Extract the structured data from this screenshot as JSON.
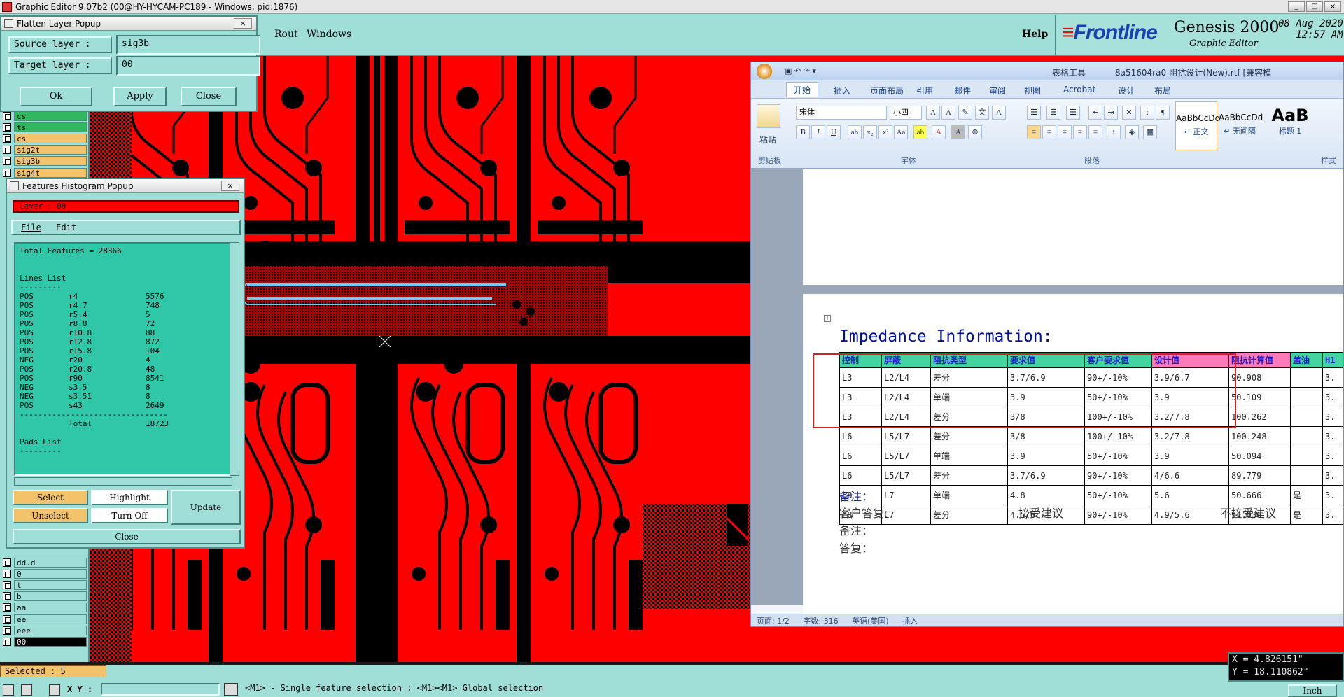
{
  "app": {
    "title": "Graphic Editor 9.07b2 (00@HY-HYCAM-PC189 - Windows, pid:1876)",
    "menu": [
      "Rout",
      "Windows"
    ],
    "help": "Help",
    "brand": {
      "logo": "Frontline",
      "product": "Genesis 2000",
      "subtitle": "Graphic Editor",
      "date": "08 Aug 2020",
      "time": "12:57 AM"
    }
  },
  "flatten_popup": {
    "title": "Flatten Layer Popup",
    "source_label": "Source layer :",
    "source_value": "sig3b",
    "target_label": "Target layer :",
    "target_value": "00",
    "buttons": [
      "Ok",
      "Apply",
      "Close"
    ]
  },
  "layers_top": [
    {
      "name": "cs",
      "style": "sel"
    },
    {
      "name": "ts",
      "style": "sel"
    },
    {
      "name": "cs",
      "style": "yel"
    },
    {
      "name": "sig2t",
      "style": "yel"
    },
    {
      "name": "sig3b",
      "style": "yel"
    },
    {
      "name": "sig4t",
      "style": "yel"
    }
  ],
  "layers_bottom": [
    {
      "name": "dd.d",
      "style": "cyan"
    },
    {
      "name": "0",
      "style": "cyan"
    },
    {
      "name": "t",
      "style": "cyan"
    },
    {
      "name": "b",
      "style": "cyan"
    },
    {
      "name": "aa",
      "style": "cyan"
    },
    {
      "name": "ee",
      "style": "cyan"
    },
    {
      "name": "eee",
      "style": "cyan"
    },
    {
      "name": "00",
      "style": "blk"
    }
  ],
  "histogram_popup": {
    "title": "Features Histogram Popup",
    "layer_label": "Layer :  00",
    "menu": [
      "File",
      "Edit"
    ],
    "total_features": "Total Features = 28366",
    "lines_heading": "Lines List",
    "lines": [
      [
        "POS",
        "r4",
        "5576"
      ],
      [
        "POS",
        "r4.7",
        "748"
      ],
      [
        "POS",
        "r5.4",
        "5"
      ],
      [
        "POS",
        "r8.8",
        "72"
      ],
      [
        "POS",
        "r10.8",
        "88"
      ],
      [
        "POS",
        "r12.8",
        "872"
      ],
      [
        "POS",
        "r15.8",
        "104"
      ],
      [
        "NEG",
        "r20",
        "4"
      ],
      [
        "POS",
        "r20.8",
        "48"
      ],
      [
        "POS",
        "r90",
        "8541"
      ],
      [
        "NEG",
        "s3.5",
        "8"
      ],
      [
        "NEG",
        "s3.51",
        "8"
      ],
      [
        "POS",
        "s43",
        "2649"
      ]
    ],
    "total_label": "Total",
    "total_value": "18723",
    "pads_heading": "Pads List",
    "buttons": {
      "select": "Select",
      "highlight": "Highlight",
      "update": "Update",
      "unselect": "Unselect",
      "turn_off": "Turn Off",
      "close": "Close"
    }
  },
  "word": {
    "doc_title": "8a51604ra0-阻抗设计(New).rtf [兼容模",
    "context_tab": "表格工具",
    "tabs": [
      "开始",
      "插入",
      "页面布局",
      "引用",
      "邮件",
      "审阅",
      "视图",
      "Acrobat",
      "设计",
      "布局"
    ],
    "font_name": "宋体",
    "font_size": "小四",
    "groups": [
      "剪贴板",
      "字体",
      "段落",
      "样式"
    ],
    "paste": "粘贴",
    "styles": [
      {
        "sample": "AaBbCcDd",
        "name": "↵ 正文"
      },
      {
        "sample": "AaBbCcDd",
        "name": "↵ 无间隔"
      },
      {
        "sample": "AaB",
        "name": "标题 1"
      }
    ],
    "heading": "Impedance Information:",
    "table_headers": [
      "控制",
      "屏蔽",
      "阻抗类型",
      "要求值",
      "客户要求值",
      "设计值",
      "阻抗计算值",
      "盖油",
      "H1"
    ],
    "table_rows": [
      [
        "L3",
        "L2/L4",
        "差分",
        "3.7/6.9",
        "90+/-10%",
        "3.9/6.7",
        "90.908",
        "",
        "3."
      ],
      [
        "L3",
        "L2/L4",
        "单端",
        "3.9",
        "50+/-10%",
        "3.9",
        "50.109",
        "",
        "3."
      ],
      [
        "L3",
        "L2/L4",
        "差分",
        "3/8",
        "100+/-10%",
        "3.2/7.8",
        "100.262",
        "",
        "3."
      ],
      [
        "L6",
        "L5/L7",
        "差分",
        "3/8",
        "100+/-10%",
        "3.2/7.8",
        "100.248",
        "",
        "3."
      ],
      [
        "L6",
        "L5/L7",
        "单端",
        "3.9",
        "50+/-10%",
        "3.9",
        "50.094",
        "",
        "3."
      ],
      [
        "L6",
        "L5/L7",
        "差分",
        "3.7/6.9",
        "90+/-10%",
        "4/6.6",
        "89.779",
        "",
        "3."
      ],
      [
        "L8",
        "L7",
        "单端",
        "4.8",
        "50+/-10%",
        "5.6",
        "50.666",
        "是",
        "3."
      ],
      [
        "L8",
        "L7",
        "差分",
        "4.5/6",
        "90+/-10%",
        "4.9/5.6",
        "91.036",
        "是",
        "3."
      ]
    ],
    "notes1": "备注：",
    "reply_label": "客户答复:",
    "accept": "接受建议",
    "reject": "不接受建议",
    "notes2": "备注：",
    "answer": "答复：",
    "status": {
      "page": "页面: 1/2",
      "words": "字数: 316",
      "lang": "英语(美国)",
      "mode": "插入"
    }
  },
  "status": {
    "selected": "Selected : 5",
    "x_label": "X Y :",
    "hint": "<M1> - Single feature selection ; <M1><M1> Global selection",
    "x_coord": "X = 4.826151\"",
    "y_coord": "Y = 18.110862\"",
    "units": "Inch"
  },
  "colors": {
    "pcb_copper": "#ff0000",
    "panel": "#9fdfd8",
    "table_header": "#44d4a0",
    "table_header_pink": "#ff7ab8"
  }
}
